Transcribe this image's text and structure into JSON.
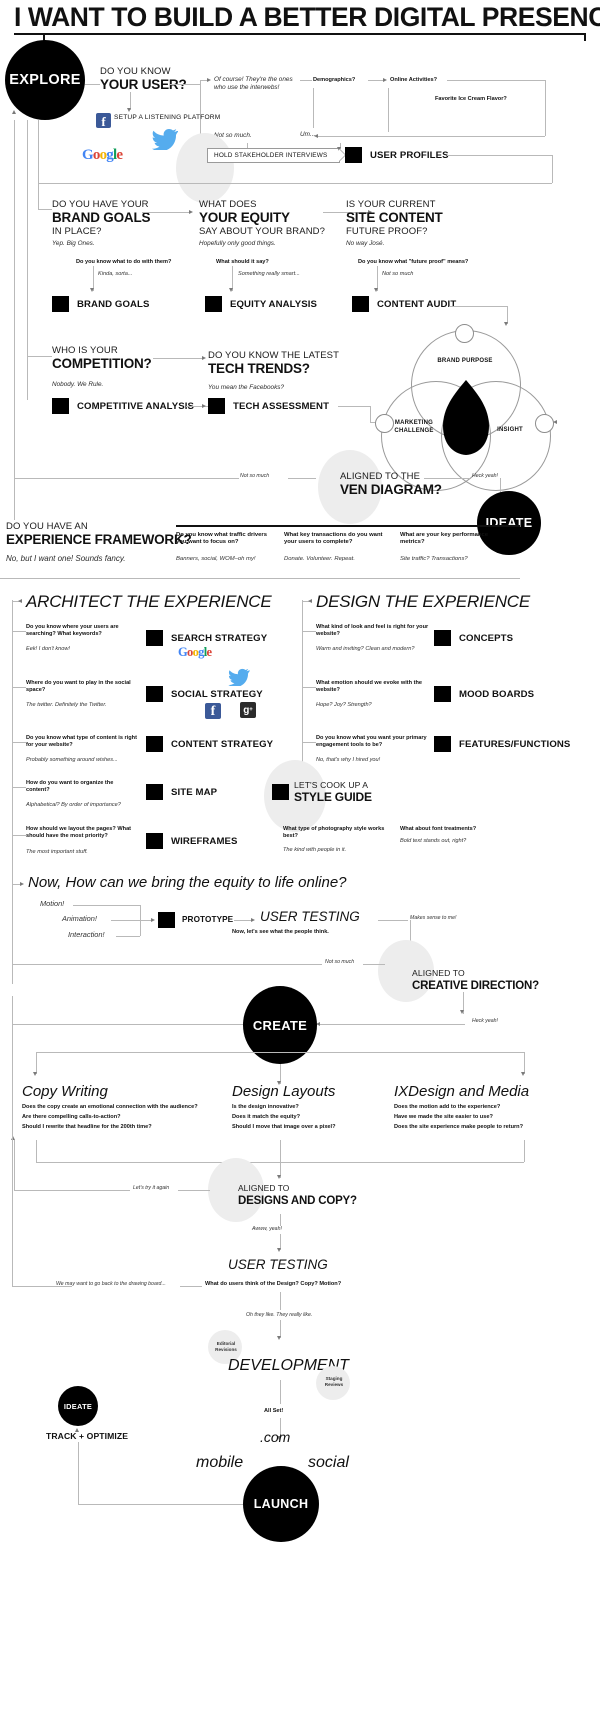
{
  "title": "I WANT TO BUILD A BETTER DIGITAL PRESENCE",
  "phases": {
    "explore": "EXPLORE",
    "ideate": "IDEATE",
    "create": "CREATE",
    "launch": "LAUNCH",
    "ideate_small": "IDEATE"
  },
  "explore": {
    "q1_light": "DO YOU KNOW",
    "q1_bold": "YOUR USER?",
    "branch_yes": "Of course! They're the ones who use the interwebs!",
    "branch_no": "Not so much.",
    "demographics": "Demographics?",
    "online_activities": "Online Activities?",
    "ice_cream": "Favorite Ice Cream Flavor?",
    "um": "Um...",
    "listening_platform": "SETUP A LISTENING PLATFORM",
    "stakeholder": "HOLD STAKEHOLDER INTERVIEWS",
    "user_profiles": "USER PROFILES",
    "google_logo": "Google",
    "twitter_icon": "twitter-bird-icon",
    "facebook_icon": "facebook-icon"
  },
  "brand": {
    "q_light": "DO YOU HAVE YOUR",
    "q_bold": "BRAND GOALS",
    "q_tail": "IN PLACE?",
    "answer": "Yep. Big Ones.",
    "subq": "Do you know what to do with them?",
    "subans": "Kinda, sorta...",
    "deliverable": "BRAND GOALS"
  },
  "equity": {
    "q_light": "WHAT DOES",
    "q_bold": "YOUR EQUITY",
    "q_tail": "SAY ABOUT YOUR BRAND?",
    "answer": "Hopefully only good things.",
    "subq": "What should it say?",
    "subans": "Something really smart...",
    "deliverable": "EQUITY ANALYSIS"
  },
  "content": {
    "q_light": "IS YOUR CURRENT",
    "q_bold": "SITE CONTENT",
    "q_tail": "FUTURE PROOF?",
    "answer": "No way José.",
    "subq": "Do you know what \"future proof\" means?",
    "subans": "Not so much",
    "deliverable": "CONTENT AUDIT"
  },
  "competition": {
    "q_light": "WHO IS YOUR",
    "q_bold": "COMPETITION?",
    "answer": "Nobody. We Rule.",
    "deliverable": "COMPETITIVE ANALYSIS"
  },
  "tech": {
    "q_light": "DO YOU KNOW THE LATEST",
    "q_bold": "TECH TRENDS?",
    "answer": "You mean the Facebooks?",
    "deliverable": "TECH ASSESSMENT"
  },
  "venn": {
    "brand_purpose": "BRAND PURPOSE",
    "marketing_challenge": "MARKETING CHALLENGE",
    "insight": "INSIGHT",
    "gate_light": "ALIGNED TO THE",
    "gate_bold": "VEN DIAGRAM?",
    "no_label": "Not so much",
    "yes_label": "Heck yeah!"
  },
  "framework": {
    "q_light": "DO YOU HAVE AN",
    "q_bold": "EXPERIENCE FRAMEWORK?",
    "answer": "No, but I want one! Sounds fancy.",
    "columns": [
      {
        "q": "Do you know what traffic drivers you want to focus on?",
        "a": "Banners, social, WOM–oh my!"
      },
      {
        "q": "What key transactions do you want your users to complete?",
        "a": "Donate. Volunteer. Repeat."
      },
      {
        "q": "What are your key performance metrics?",
        "a": "Site traffic? Transactions?"
      }
    ]
  },
  "architect": {
    "heading": "ARCHITECT THE EXPERIENCE",
    "rows": [
      {
        "q": "Do you know where your users are searching? What keywords?",
        "a": "Eek! I don't know!",
        "deliverable": "SEARCH STRATEGY",
        "brand": "google"
      },
      {
        "q": "Where do you want to play in the social space?",
        "a": "The twitter. Definitely the Twitter.",
        "deliverable": "SOCIAL STRATEGY",
        "brand": "social"
      },
      {
        "q": "Do you know what type of content is right for your website?",
        "a": "Probably something around wishes...",
        "deliverable": "CONTENT STRATEGY",
        "brand": ""
      },
      {
        "q": "How do you want to organize the content?",
        "a": "Alphabetical? By order of importance?",
        "deliverable": "SITE MAP",
        "brand": ""
      },
      {
        "q": "How should we layout the pages? What should have the most priority?",
        "a": "The most important stuff.",
        "deliverable": "WIREFRAMES",
        "brand": ""
      }
    ]
  },
  "design": {
    "heading": "DESIGN THE EXPERIENCE",
    "rows": [
      {
        "q": "What kind of look and feel is right for your website?",
        "a": "Warm and inviting? Clean and modern?",
        "deliverable": "CONCEPTS"
      },
      {
        "q": "What emotion should we evoke with the website?",
        "a": "Hope? Joy? Strength?",
        "deliverable": "MOOD BOARDS"
      },
      {
        "q": "Do you know what you want your primary engagement tools to be?",
        "a": "No, that's why I hired you!",
        "deliverable": "FEATURES/FUNCTIONS"
      }
    ],
    "styleguide_light": "LET'S COOK UP A",
    "styleguide_bold": "STYLE GUIDE",
    "photo_q": "What type of photography style works best?",
    "photo_a": "The kind with people in it.",
    "font_q": "What about font treatments?",
    "font_a": "Bold text stands out, right?"
  },
  "prototype": {
    "heading": "Now, How can we bring the equity to life online?",
    "motion": "Motion!",
    "animation": "Animation!",
    "interaction": "Interaction!",
    "deliverable": "PROTOTYPE",
    "user_testing": "USER TESTING",
    "user_testing_sub": "Now, let's see what the people think.",
    "makes_sense": "Makes sense to me!",
    "not_so_much": "Not so much",
    "gate_light": "ALIGNED TO",
    "gate_bold": "CREATIVE DIRECTION?",
    "heck_yeah": "Heck yeah!"
  },
  "create": {
    "columns": [
      {
        "title": "Copy Writing",
        "lines": [
          "Does the copy create an emotional connection with the audience?",
          "Are there compelling calls-to-action?",
          "Should I rewrite that headline for the 200th time?"
        ]
      },
      {
        "title": "Design Layouts",
        "lines": [
          "Is the design innovative?",
          "Does it match the equity?",
          "Should I move that image over a pixel?"
        ]
      },
      {
        "title": "IXDesign and Media",
        "lines": [
          "Does the motion add to the experience?",
          "Have we made the site easier to use?",
          "Does the site experience make people to return?"
        ]
      }
    ],
    "gate_light": "ALIGNED TO",
    "gate_bold": "DESIGNS AND COPY?",
    "retry": "Let's try it again",
    "yes": "Awww, yeah!",
    "user_testing": "USER TESTING",
    "user_testing_sub": "What do users think of the Design? Copy? Motion?",
    "drawing_board": "We may want to go back to the drawing board...",
    "they_like": "Oh they like. They really like."
  },
  "launch": {
    "editorial": "Editorial Revisions",
    "staging": "Staging Reviews",
    "development": "DEVELOPMENT",
    "all_set": "All Set!",
    "dotcom": ".com",
    "mobile": "mobile",
    "social": "social",
    "track": "TRACK + OPTIMIZE"
  }
}
